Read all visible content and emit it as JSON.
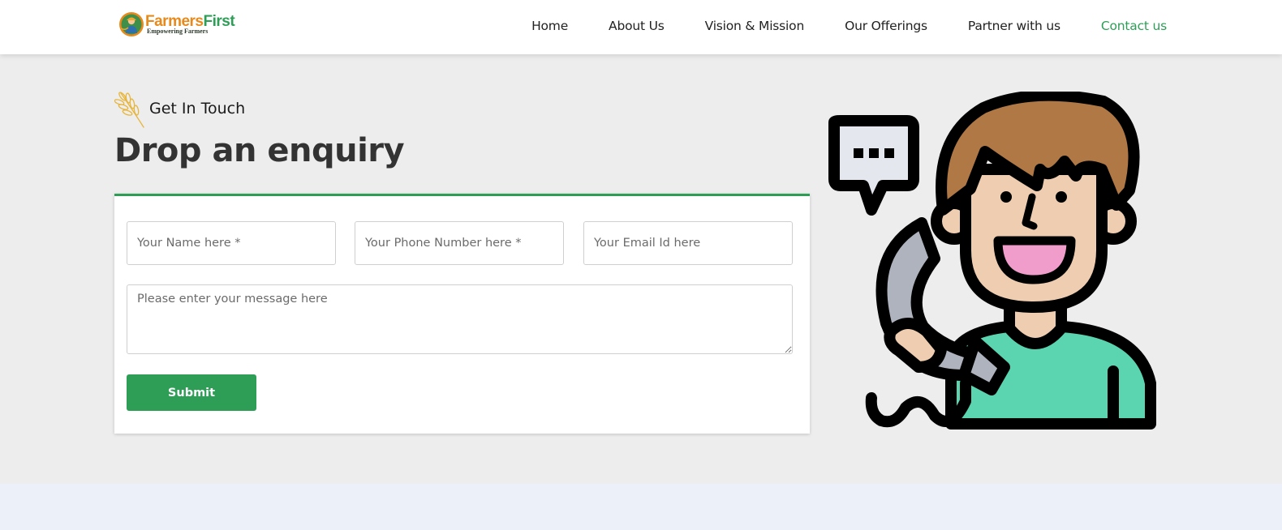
{
  "brand": {
    "name_part1": "Farmers",
    "name_part2": "First",
    "tagline": "Empowering Farmers",
    "colors": {
      "orange": "#e8891b",
      "green": "#2e9e57"
    }
  },
  "nav": {
    "items": [
      {
        "label": "Home"
      },
      {
        "label": "About Us"
      },
      {
        "label": "Vision & Mission"
      },
      {
        "label": "Our Offerings"
      },
      {
        "label": "Partner with us"
      },
      {
        "label": "Contact us",
        "active": true
      }
    ]
  },
  "section": {
    "label": "Get In Touch",
    "label_icon": "wheat-icon",
    "title": "Drop an enquiry"
  },
  "form": {
    "name_placeholder": "Your Name here *",
    "phone_placeholder": "Your Phone Number here *",
    "email_placeholder": "Your Email Id here",
    "message_placeholder": "Please enter your message here",
    "submit_label": "Submit"
  },
  "illustration": {
    "icon": "customer-support-phone-icon"
  },
  "colors": {
    "accent": "#2e9e57",
    "page_bg": "#ededed",
    "footer_bg": "#ecf0f8"
  }
}
